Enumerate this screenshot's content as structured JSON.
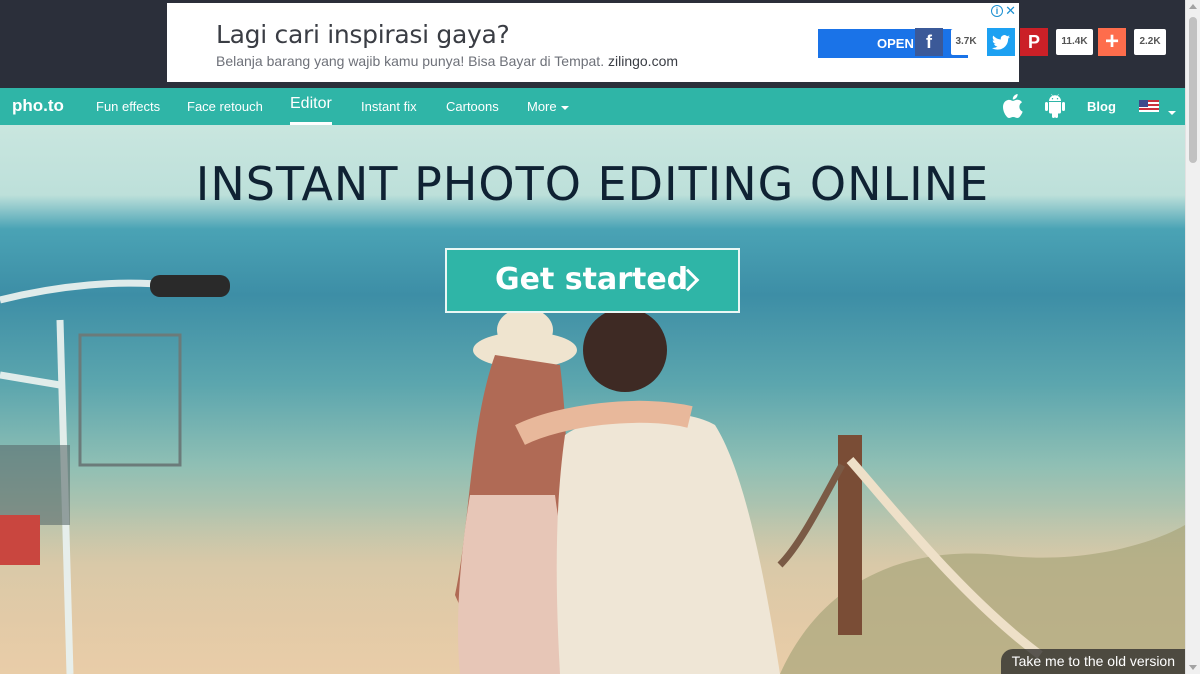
{
  "ad": {
    "title": "Lagi cari inspirasi gaya?",
    "subtitle": "Belanja barang yang wajib kamu punya! Bisa Bayar di Tempat.",
    "domain": "zilingo.com",
    "open_label": "OPEN",
    "info_icon": "info-icon",
    "close_icon": "close-icon"
  },
  "share": {
    "facebook": {
      "icon": "facebook-icon",
      "glyph": "f",
      "count": "3.7K",
      "color": "#3b5998"
    },
    "twitter": {
      "icon": "twitter-icon",
      "glyph": "t",
      "color": "#1da1f2"
    },
    "pinterest": {
      "icon": "pinterest-icon",
      "glyph": "P",
      "count": "11.4K",
      "color": "#cb2027"
    },
    "addthis": {
      "icon": "plus-icon",
      "glyph": "+",
      "count": "2.2K",
      "color": "#fe6d4c"
    }
  },
  "nav": {
    "logo": "pho.to",
    "items": [
      {
        "label": "Fun effects"
      },
      {
        "label": "Face retouch"
      },
      {
        "label": "Editor",
        "active": true
      },
      {
        "label": "Instant fix"
      },
      {
        "label": "Cartoons"
      },
      {
        "label": "More"
      }
    ],
    "apple_icon": "apple-icon",
    "android_icon": "android-icon",
    "blog": "Blog",
    "language_icon": "us-flag-icon"
  },
  "hero": {
    "title": "INSTANT PHOTO EDITING ONLINE",
    "cta": "Get started",
    "old_version": "Take me to the old version"
  },
  "colors": {
    "brand": "#2fb5a7",
    "topband": "#2b2f3a"
  }
}
